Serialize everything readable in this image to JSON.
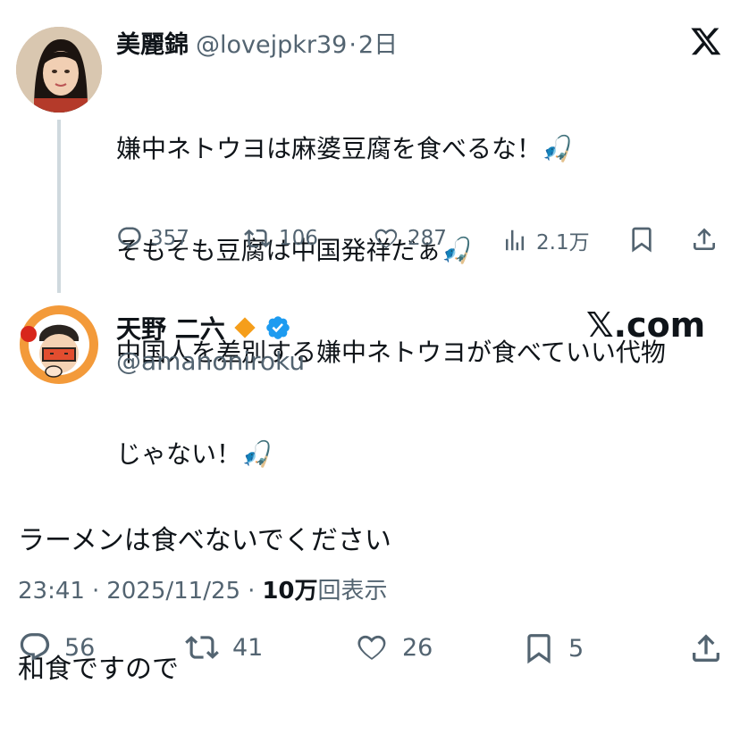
{
  "quoted_tweet": {
    "author_name": "美麗錦",
    "author_handle": "@lovejpkr39",
    "separator": "·",
    "time_ago": "2日",
    "x_logo": "𝕏",
    "lines": [
      "嫌中ネトウヨは麻婆豆腐を食べるな！",
      "そもそも豆腐は中国発祥だぁ",
      "中国人を差別する嫌中ネトウヨが食べていい代物",
      "じゃない！"
    ],
    "fishing_emoji": "🎣",
    "metrics": {
      "replies": "357",
      "reposts": "106",
      "likes": "287",
      "views": "2.1万"
    }
  },
  "main_tweet": {
    "author_name": "天野 二六",
    "author_handle": "@amanoniroku",
    "site_label": "𝕏.com",
    "lines": [
      "ラーメンは食べないでください",
      "和食ですので"
    ],
    "time": "23:41",
    "sep1": "·",
    "date": "2025/11/25",
    "sep2": "·",
    "views_count": "10万",
    "views_suffix": "回表示",
    "metrics": {
      "replies": "56",
      "reposts": "41",
      "likes": "26",
      "bookmarks": "5"
    }
  },
  "colors": {
    "text": "#0f1419",
    "muted": "#536471",
    "verified": "#1d9bf0",
    "badge_orange": "#f59e1b",
    "thread_line": "#cfd9de"
  }
}
